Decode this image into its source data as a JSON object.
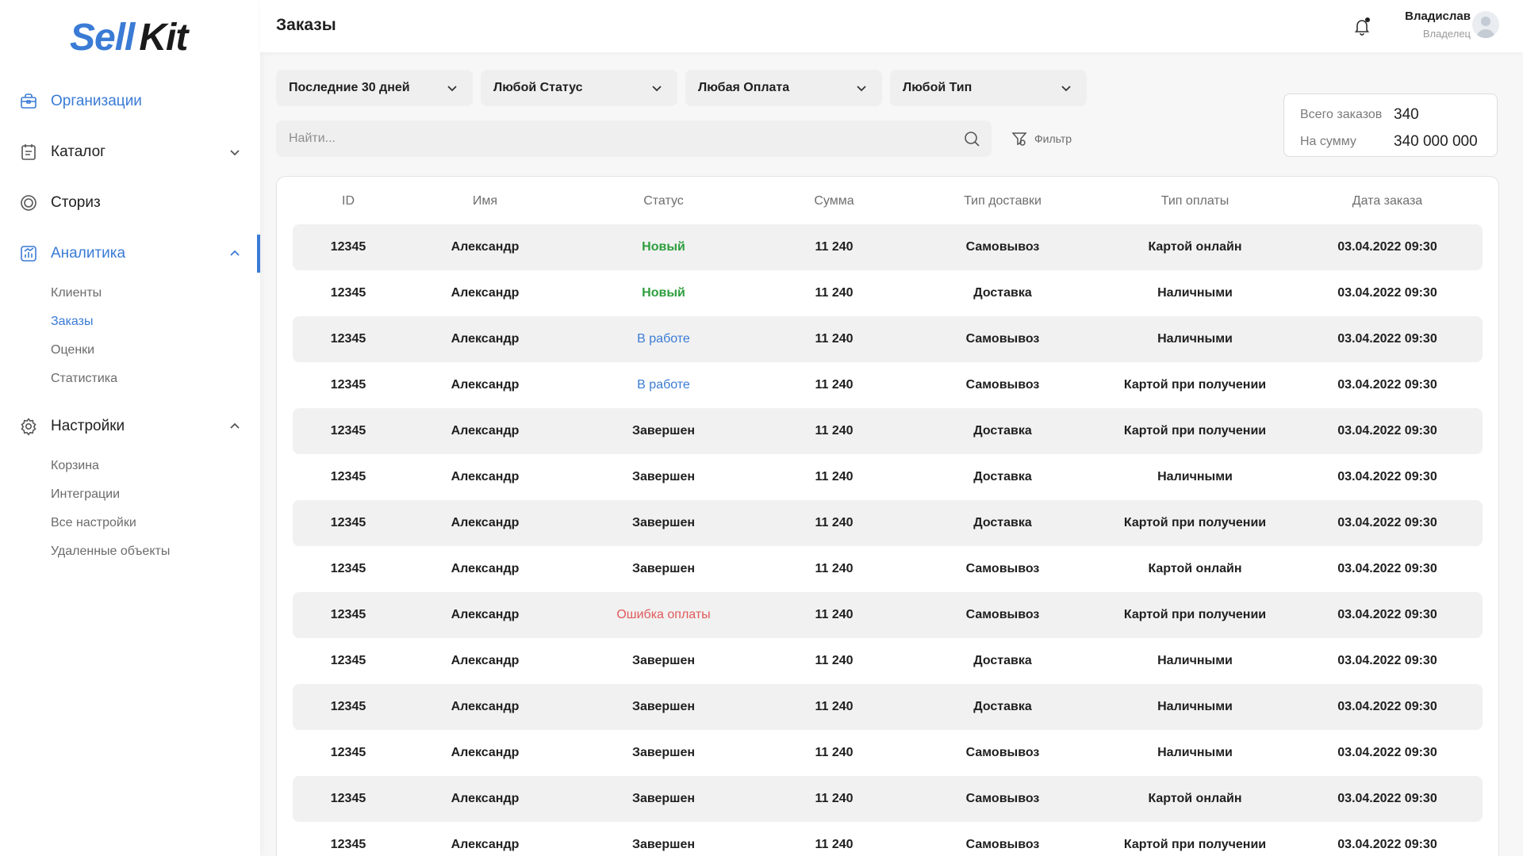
{
  "logo": {
    "part1": "Sell",
    "part2": "Kit"
  },
  "sidebar": {
    "items": [
      {
        "label": "Организации",
        "icon": "briefcase-icon"
      },
      {
        "label": "Каталог",
        "icon": "catalog-icon"
      },
      {
        "label": "Сториз",
        "icon": "stories-icon"
      },
      {
        "label": "Аналитика",
        "icon": "analytics-icon"
      },
      {
        "label": "Настройки",
        "icon": "gear-icon"
      }
    ],
    "analytics_sub": [
      "Клиенты",
      "Заказы",
      "Оценки",
      "Статистика"
    ],
    "settings_sub": [
      "Корзина",
      "Интеграции",
      "Все настройки",
      "Удаленные объекты"
    ]
  },
  "header": {
    "title": "Заказы",
    "user_name": "Владислав",
    "user_role": "Владелец"
  },
  "filters": {
    "period": "Последние 30 дней",
    "status": "Любой Статус",
    "payment": "Любая Оплата",
    "type": "Любой Тип",
    "search_placeholder": "Найти...",
    "filter_label": "Фильтр"
  },
  "totals": {
    "orders_label": "Всего заказов",
    "orders_value": "340",
    "sum_label": "На сумму",
    "sum_value": "340 000 000"
  },
  "table": {
    "columns": [
      "ID",
      "Имя",
      "Статус",
      "Сумма",
      "Тип доставки",
      "Тип оплаты",
      "Дата заказа"
    ],
    "rows": [
      [
        "12345",
        "Александр",
        "Новый",
        "11 240",
        "Самовывоз",
        "Картой онлайн",
        "03.04.2022 09:30"
      ],
      [
        "12345",
        "Александр",
        "Новый",
        "11 240",
        "Доставка",
        "Наличными",
        "03.04.2022 09:30"
      ],
      [
        "12345",
        "Александр",
        "В работе",
        "11 240",
        "Самовывоз",
        "Наличными",
        "03.04.2022 09:30"
      ],
      [
        "12345",
        "Александр",
        "В работе",
        "11 240",
        "Самовывоз",
        "Картой при получении",
        "03.04.2022 09:30"
      ],
      [
        "12345",
        "Александр",
        "Завершен",
        "11 240",
        "Доставка",
        "Картой при получении",
        "03.04.2022 09:30"
      ],
      [
        "12345",
        "Александр",
        "Завершен",
        "11 240",
        "Доставка",
        "Наличными",
        "03.04.2022 09:30"
      ],
      [
        "12345",
        "Александр",
        "Завершен",
        "11 240",
        "Доставка",
        "Картой при получении",
        "03.04.2022 09:30"
      ],
      [
        "12345",
        "Александр",
        "Завершен",
        "11 240",
        "Самовывоз",
        "Картой онлайн",
        "03.04.2022 09:30"
      ],
      [
        "12345",
        "Александр",
        "Ошибка оплаты",
        "11 240",
        "Самовывоз",
        "Картой при получении",
        "03.04.2022 09:30"
      ],
      [
        "12345",
        "Александр",
        "Завершен",
        "11 240",
        "Доставка",
        "Наличными",
        "03.04.2022 09:30"
      ],
      [
        "12345",
        "Александр",
        "Завершен",
        "11 240",
        "Доставка",
        "Наличными",
        "03.04.2022 09:30"
      ],
      [
        "12345",
        "Александр",
        "Завершен",
        "11 240",
        "Самовывоз",
        "Наличными",
        "03.04.2022 09:30"
      ],
      [
        "12345",
        "Александр",
        "Завершен",
        "11 240",
        "Самовывоз",
        "Картой онлайн",
        "03.04.2022 09:30"
      ],
      [
        "12345",
        "Александр",
        "Завершен",
        "11 240",
        "Самовывоз",
        "Картой при получении",
        "03.04.2022 09:30"
      ]
    ]
  },
  "colors": {
    "accent": "#3a7bd5",
    "status_new": "#2e9e3e",
    "status_error": "#e05a5a"
  }
}
